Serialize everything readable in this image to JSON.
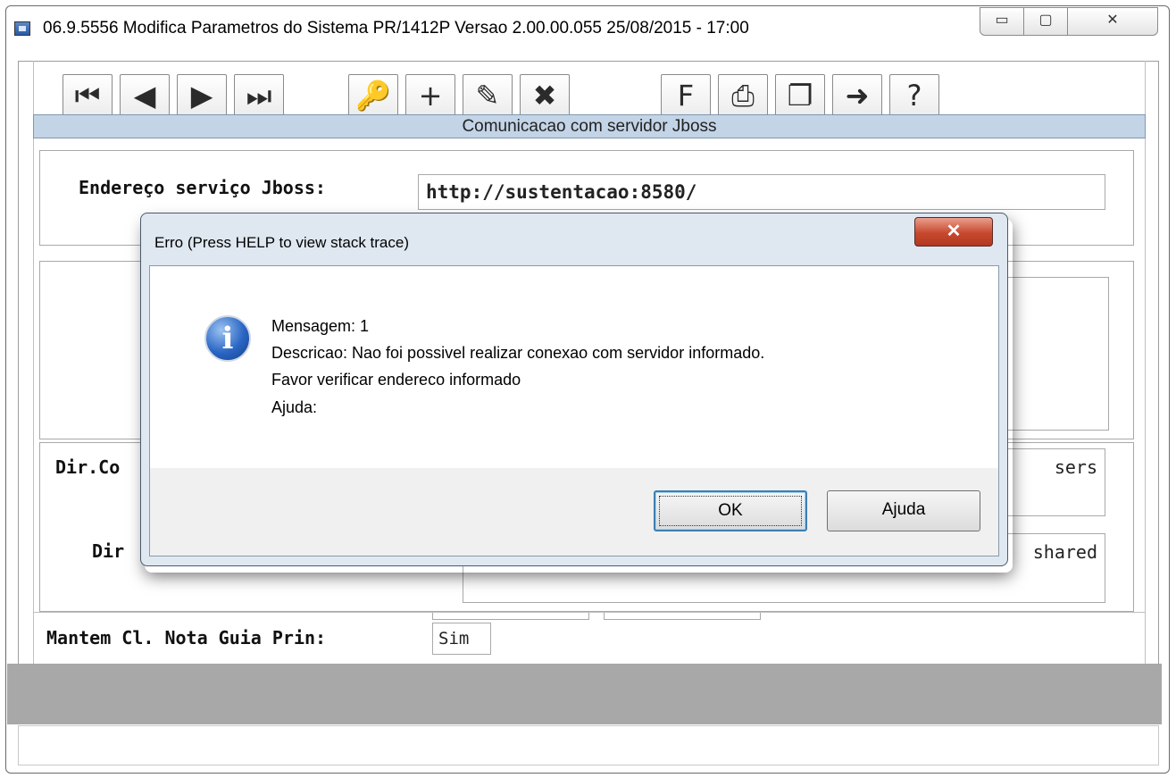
{
  "window": {
    "title": "06.9.5556  Modifica  Parametros do Sistema PR/1412P Versao 2.00.00.055 25/08/2015 - 17:00",
    "minimize_glyph": "▭",
    "maximize_glyph": "▢",
    "close_glyph": "✕"
  },
  "toolbar": {
    "buttons": [
      {
        "name": "first-record-button",
        "glyph": "⏮"
      },
      {
        "name": "previous-record-button",
        "glyph": "◀"
      },
      {
        "name": "next-record-button",
        "glyph": "▶"
      },
      {
        "name": "last-record-button",
        "glyph": "⏭"
      },
      {
        "name": "search-key-button",
        "glyph": "🔑"
      },
      {
        "name": "add-record-button",
        "glyph": "+"
      },
      {
        "name": "edit-record-button",
        "glyph": "✎"
      },
      {
        "name": "delete-record-button",
        "glyph": "✖"
      },
      {
        "name": "filter-button",
        "glyph": "F"
      },
      {
        "name": "print-button",
        "glyph": "⎙"
      },
      {
        "name": "copy-button",
        "glyph": "❐"
      },
      {
        "name": "exit-button",
        "glyph": "➜"
      },
      {
        "name": "help-button",
        "glyph": "?"
      }
    ]
  },
  "frame": {
    "header": "Comunicacao com servidor Jboss"
  },
  "form": {
    "jboss_label": "Endereço serviço Jboss:",
    "jboss_value": "http://sustentacao:8580/",
    "dir_co_label": "Dir.Co",
    "dir_co_value": "sers",
    "dir_label": "Dir",
    "dir_value": "shared",
    "mantem_label": "Mantem Cl. Nota Guia Prin:",
    "mantem_value": "Sim"
  },
  "dialog": {
    "title": "Erro (Press HELP to view stack trace)",
    "close_glyph": "✕",
    "icon": "info-icon",
    "icon_glyph": "i",
    "lines": [
      "Mensagem: 1",
      "Descricao:  Nao foi possivel realizar conexao com servidor informado.",
      "Favor verificar endereco informado",
      "Ajuda:"
    ],
    "ok_label": "OK",
    "help_label": "Ajuda"
  },
  "colors": {
    "frame_header_bg": "#c3d4e7",
    "gray_panel": "#a8a8a8",
    "dialog_close_red": "#c8482e",
    "ok_focus_blue": "#3c7fb1"
  }
}
